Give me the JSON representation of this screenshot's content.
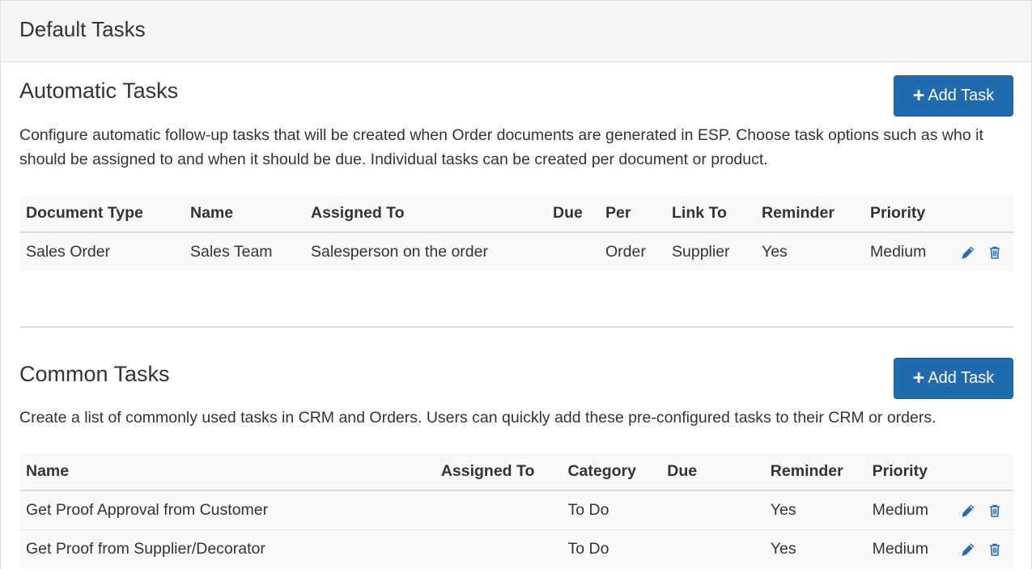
{
  "panel": {
    "title": "Default Tasks"
  },
  "automatic": {
    "title": "Automatic Tasks",
    "add_button": "Add Task",
    "description": "Configure automatic follow-up tasks that will be created when Order documents are generated in ESP. Choose task options such as who it should be assigned to and when it should be due. Individual tasks can be created per document or product.",
    "columns": [
      "Document Type",
      "Name",
      "Assigned To",
      "Due",
      "Per",
      "Link To",
      "Reminder",
      "Priority"
    ],
    "rows": [
      [
        "Sales Order",
        "Sales Team",
        "Salesperson on the order",
        "",
        "Order",
        "Supplier",
        "Yes",
        "Medium"
      ]
    ]
  },
  "common": {
    "title": "Common Tasks",
    "add_button": "Add Task",
    "description": "Create a list of commonly used tasks in CRM and Orders. Users can quickly add these pre-configured tasks to their CRM or orders.",
    "columns": [
      "Name",
      "Assigned To",
      "Category",
      "Due",
      "Reminder",
      "Priority"
    ],
    "rows": [
      [
        "Get Proof Approval from Customer",
        "",
        "To Do",
        "",
        "Yes",
        "Medium"
      ],
      [
        "Get Proof from Supplier/Decorator",
        "",
        "To Do",
        "",
        "Yes",
        "Medium"
      ]
    ]
  },
  "icons": {
    "edit": "pencil-icon",
    "delete": "trash-icon",
    "add": "plus-icon"
  },
  "colors": {
    "primary": "#1f6bad",
    "icon": "#2a6db0",
    "heading_bg": "#f5f5f5"
  }
}
